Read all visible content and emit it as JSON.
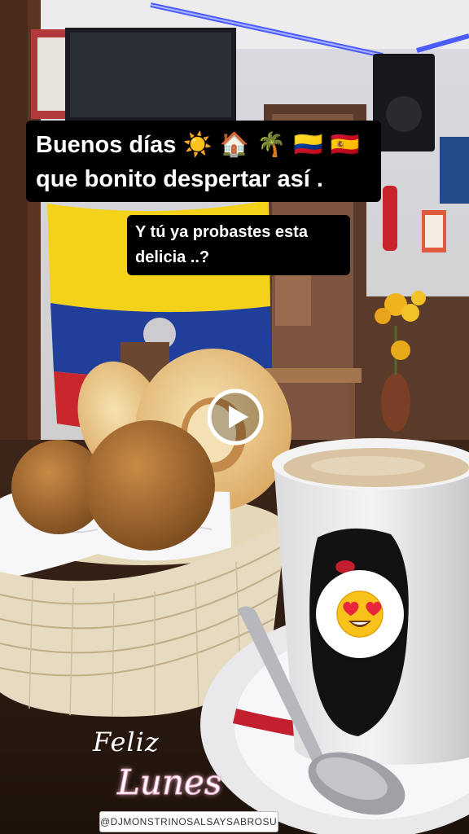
{
  "story": {
    "caption_main": {
      "line1": "Buenos días",
      "line1_emojis": "☀️ 🏠 🌴 🇨🇴 🇪🇸",
      "line2": "que bonito despertar así ."
    },
    "caption_question": {
      "line1": "Y tú ya probastes esta",
      "line2": "delicia ..?"
    },
    "reaction_sticker": {
      "emoji": "😍"
    },
    "greeting_sticker": {
      "word1": "Feliz",
      "word2": "Lunes"
    },
    "mention": "@DJMONSTRINOSALSAYSABROSURA"
  },
  "colors": {
    "caption_bg": "#000000",
    "caption_text": "#ffffff",
    "neon_blue": "#3a4cff",
    "flag_yellow": "#f5d21a",
    "flag_blue": "#1f3f9a",
    "flag_red": "#c8262c",
    "coffee_foam": "#d8c4a2",
    "pink_glow": "#f1a8c8"
  },
  "icons": {
    "play": "play-icon",
    "reaction": "heart-eyes-emoji-icon"
  }
}
